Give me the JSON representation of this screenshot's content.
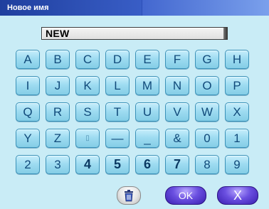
{
  "window": {
    "title": "Новое имя"
  },
  "input": {
    "value": "NEW"
  },
  "keys": [
    [
      "A",
      "B",
      "C",
      "D",
      "E",
      "F",
      "G",
      "H"
    ],
    [
      "I",
      "J",
      "K",
      "L",
      "M",
      "N",
      "O",
      "P"
    ],
    [
      "Q",
      "R",
      "S",
      "T",
      "U",
      "V",
      "W",
      "X"
    ],
    [
      "Y",
      "Z",
      "▯",
      "—",
      "_",
      "&",
      "0",
      "1"
    ],
    [
      "2",
      "3",
      "4",
      "5",
      "6",
      "7",
      "8",
      "9"
    ]
  ],
  "bold_keys": [
    "4",
    "5",
    "6",
    "7"
  ],
  "buttons": {
    "delete_icon": "trash-icon",
    "ok": "OK",
    "cancel": "X"
  },
  "colors": {
    "titlebar": "#1f3f9e",
    "background": "#c9ecf6",
    "key": "#9fdcf1",
    "confirm_button": "#5a3fd6"
  }
}
